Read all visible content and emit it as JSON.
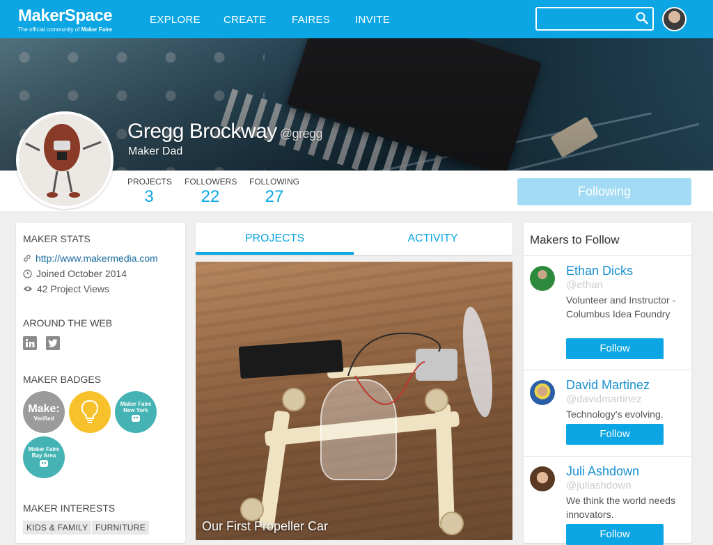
{
  "nav": {
    "logo": "MakerSpace",
    "tagline_pre": "The official community of",
    "tagline_brand": "Maker Faire",
    "items": [
      "EXPLORE",
      "CREATE",
      "FAIRES",
      "INVITE"
    ],
    "search_placeholder": ""
  },
  "profile": {
    "name": "Gregg Brockway",
    "handle": "@gregg",
    "title": "Maker Dad",
    "stats": [
      {
        "label": "PROJECTS",
        "value": "3"
      },
      {
        "label": "FOLLOWERS",
        "value": "22"
      },
      {
        "label": "FOLLOWING",
        "value": "27"
      }
    ],
    "following_label": "Following"
  },
  "sidebar": {
    "stats_title": "MAKER STATS",
    "website": "http://www.makermedia.com",
    "joined": "Joined October 2014",
    "views": "42 Project Views",
    "web_title": "AROUND THE WEB",
    "badges_title": "MAKER BADGES",
    "badges": [
      {
        "line1": "Make:",
        "line2": "Verified",
        "color": "#9b9b9b"
      },
      {
        "line1": "",
        "line2": "",
        "color": "#f6c12a"
      },
      {
        "line1": "Maker Faire",
        "line2": "New York",
        "color": "#45b3b3"
      },
      {
        "line1": "Maker Faire",
        "line2": "Bay Area",
        "color": "#45b3b3"
      }
    ],
    "interests_title": "MAKER INTERESTS",
    "interests": [
      "KIDS & FAMILY",
      "FURNITURE"
    ]
  },
  "tabs": [
    "PROJECTS",
    "ACTIVITY"
  ],
  "project": {
    "caption": "Our First Propeller Car"
  },
  "makers": {
    "title": "Makers to Follow",
    "follow_label": "Follow",
    "list": [
      {
        "name": "Ethan Dicks",
        "handle": "@ethan",
        "desc": "Volunteer and Instructor - Columbus Idea Foundry"
      },
      {
        "name": "David Martinez",
        "handle": "@davidmartinez",
        "desc": "Technology's evolving."
      },
      {
        "name": "Juli Ashdown",
        "handle": "@juliashdown",
        "desc": "We think the world needs innovators."
      }
    ]
  },
  "colors": {
    "brand": "#0ba6e3",
    "link": "#1a8fd0"
  }
}
